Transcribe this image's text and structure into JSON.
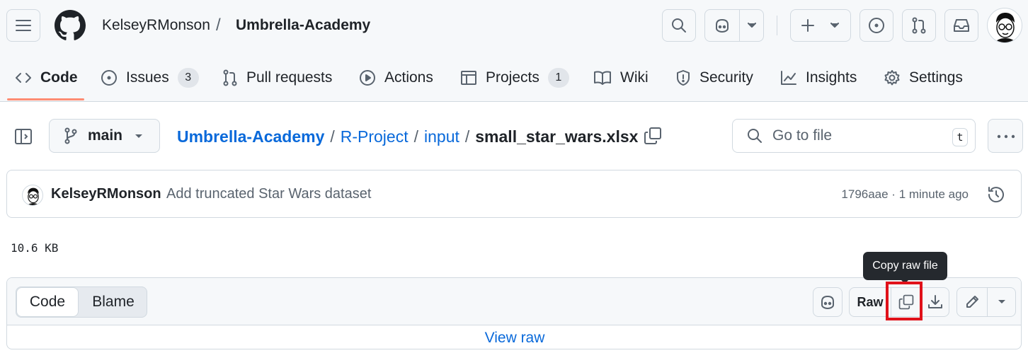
{
  "header": {
    "owner": "KelseyRMonson",
    "separator": "/",
    "repo": "Umbrella-Academy"
  },
  "tabs": [
    {
      "label": "Code",
      "icon": "code-icon",
      "selected": true
    },
    {
      "label": "Issues",
      "icon": "issue-opened-icon",
      "count": "3"
    },
    {
      "label": "Pull requests",
      "icon": "git-pull-request-icon"
    },
    {
      "label": "Actions",
      "icon": "play-icon"
    },
    {
      "label": "Projects",
      "icon": "table-icon",
      "count": "1"
    },
    {
      "label": "Wiki",
      "icon": "book-icon"
    },
    {
      "label": "Security",
      "icon": "shield-icon"
    },
    {
      "label": "Insights",
      "icon": "graph-icon"
    },
    {
      "label": "Settings",
      "icon": "gear-icon"
    }
  ],
  "file_nav": {
    "branch": "main",
    "breadcrumb": [
      "Umbrella-Academy",
      "R-Project",
      "input"
    ],
    "breadcrumb_sep": "/",
    "file_name": "small_star_wars.xlsx",
    "go_to_file_placeholder": "Go to file",
    "go_to_file_shortcut": "t"
  },
  "commit": {
    "author": "KelseyRMonson",
    "message": "Add truncated Star Wars dataset",
    "meta": "1796aae · 1 minute ago"
  },
  "file_size": "10.6 KB",
  "file_view": {
    "code_tab": "Code",
    "blame_tab": "Blame",
    "raw_button": "Raw",
    "view_raw_link": "View raw",
    "tooltip": "Copy raw file"
  },
  "colors": {
    "accent_link": "#0969da",
    "tab_underline": "#fd8c73",
    "highlight_box": "#e0111a"
  }
}
